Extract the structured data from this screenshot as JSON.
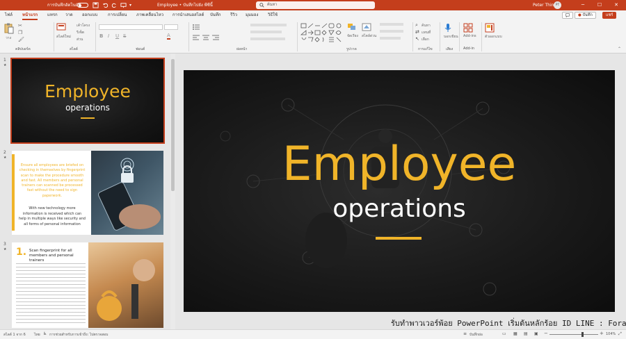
{
  "titlebar": {
    "autosave_label": "การบันทึกอัตโนมัติ",
    "document_title": "Employee • บันทึกไปยัง พีซีนี้",
    "search_placeholder": "ค้นหา",
    "user_name": "Peter Thind",
    "user_initials": "PT"
  },
  "menu": {
    "tabs": [
      "ไฟล์",
      "หน้าแรก",
      "แทรก",
      "วาด",
      "ออกแบบ",
      "การเปลี่ยน",
      "ภาพเคลื่อนไหว",
      "การนำเสนอสไลด์",
      "บันทึก",
      "รีวิว",
      "มุมมอง",
      "วิธีใช้"
    ],
    "active_tab": "หน้าแรก",
    "record_button": "บันทึก",
    "share_button": "แชร์"
  },
  "ribbon": {
    "groups": [
      "คลิปบอร์ด",
      "สไลด์",
      "ฟอนต์",
      "ย่อหน้า",
      "รูปวาด",
      "การแก้ไข",
      "เสียง",
      "Add-in"
    ],
    "buttons": {
      "paste": "วาง",
      "new_slide": "สไลด์ใหม่",
      "layout": "เค้าโครง",
      "reset": "รีเซ็ต",
      "section": "ส่วน",
      "find": "ค้นหา",
      "replace": "แทนที่",
      "select": "เลือก",
      "dictate": "บอกเขียน",
      "addins": "Add-ins",
      "designer": "ตัวออกแบบ",
      "arrange": "จัดเรียง",
      "quick_styles": "สไตล์ด่วน"
    }
  },
  "slides": [
    {
      "number": "1",
      "title": "Employee",
      "subtitle": "operations"
    },
    {
      "number": "2",
      "para1": "Ensure all employees are briefed on checking in themselves by fingerprint scan to make the procedure smooth and fast. All members and personal trainers can scanned be processed fast without the need to sign paperwork.",
      "para2": "With new technology more information is received which can help in multiple ways like security and all forms of personal information"
    },
    {
      "number": "3",
      "step": "1.",
      "heading": "Scan fingerprint for all members and personal trainers"
    }
  ],
  "main_slide": {
    "title": "Employee",
    "subtitle": "operations"
  },
  "watermark": "รับทำพาวเวอร์พ้อย PowerPoint เริ่มต้นหลักร้อย ID LINE : Forartwork",
  "statusbar": {
    "slide_info": "สไลด์ 1 จาก 6",
    "language": "ไทย",
    "accessibility": "การช่วยสำหรับการเข้าถึง: ไปตรวจสอบ",
    "notes": "บันทึกย่อ",
    "zoom": "104%"
  },
  "colors": {
    "accent": "#c43e1c",
    "slide_gold": "#f0b429",
    "slide_dark": "#141414"
  }
}
